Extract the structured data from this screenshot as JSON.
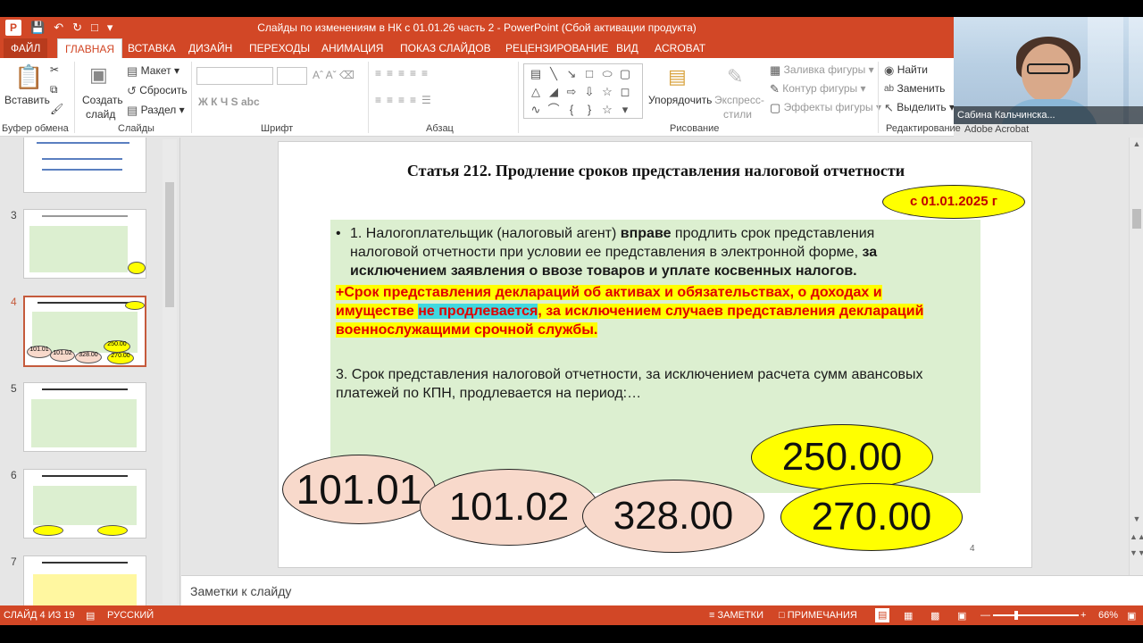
{
  "window": {
    "title": "Слайды по изменениям в НК с 01.01.26 часть 2 -  PowerPoint (Сбой активации продукта)",
    "app_icon": "P"
  },
  "colors": {
    "accent": "#d24726",
    "slide_green": "#dcefd0",
    "highlight_yellow": "#ffff00",
    "highlight_cyan": "#3fd8e0",
    "red_text": "#e00000",
    "ellipse_pink": "#f8d9cb"
  },
  "tabs": [
    "ФАЙЛ",
    "ГЛАВНАЯ",
    "ВСТАВКА",
    "ДИЗАЙН",
    "ПЕРЕХОДЫ",
    "АНИМАЦИЯ",
    "ПОКАЗ СЛАЙДОВ",
    "РЕЦЕНЗИРОВАНИЕ",
    "ВИД",
    "ACROBAT"
  ],
  "ribbon": {
    "paste": "Вставить",
    "new_slide_1": "Создать",
    "new_slide_2": "слайд",
    "layout": "Макет",
    "reset": "Сбросить",
    "section": "Раздел",
    "arrange": "Упорядочить",
    "quick_styles_1": "Экспресс-",
    "quick_styles_2": "стили",
    "shape_fill": "Заливка фигуры",
    "shape_outline": "Контур фигуры",
    "shape_effects": "Эффекты фигуры",
    "find": "Найти",
    "replace": "Заменить",
    "select": "Выделить",
    "groups": {
      "clipboard": "Буфер обмена",
      "slides": "Слайды",
      "font": "Шрифт",
      "paragraph": "Абзац",
      "drawing": "Рисование",
      "editing": "Редактирование",
      "acrobat": "Adobe Acrobat"
    },
    "font_buttons": "Ж  К  Ч  S  abc"
  },
  "webcam": {
    "name": "Сабина Кальчинска..."
  },
  "thumbnails": {
    "numbers": [
      "3",
      "4",
      "5",
      "6",
      "7"
    ],
    "selected": "4",
    "thumb4_values": [
      "101.01",
      "101.02",
      "328.00",
      "250.00",
      "270.00"
    ]
  },
  "slide": {
    "title": "Статья 212. Продление сроков представления налоговой отчетности",
    "date_badge": "с 01.01.2025 г",
    "p1_bullet": "•",
    "p1_a": "1. Налогоплательщик (налоговый агент) ",
    "p1_b": "вправе",
    "p1_c": " продлить срок представления налоговой отчетности при условии ее представления в электронной форме, ",
    "p1_d": "за исключением заявления о ввозе товаров и уплате косвенных налогов.",
    "p2_a": "+Срок представления деклараций об активах и обязательствах, о доходах и имуществе ",
    "p2_b": "не продлевается",
    "p2_c": ", за исключением случаев представления деклараций военнослужащими срочной службы.",
    "p3": "3. Срок представления налоговой отчетности, за исключением расчета сумм авансовых платежей по КПН, продлевается на период:…",
    "codes": [
      "101.01",
      "101.02",
      "328.00",
      "250.00",
      "270.00"
    ],
    "slide_number": "4"
  },
  "notes": {
    "placeholder": "Заметки к слайду"
  },
  "status": {
    "slide_info": "СЛАЙД 4 ИЗ 19",
    "language": "РУССКИЙ",
    "notes": "ЗАМЕТКИ",
    "comments": "ПРИМЕЧАНИЯ",
    "zoom": "66%"
  }
}
